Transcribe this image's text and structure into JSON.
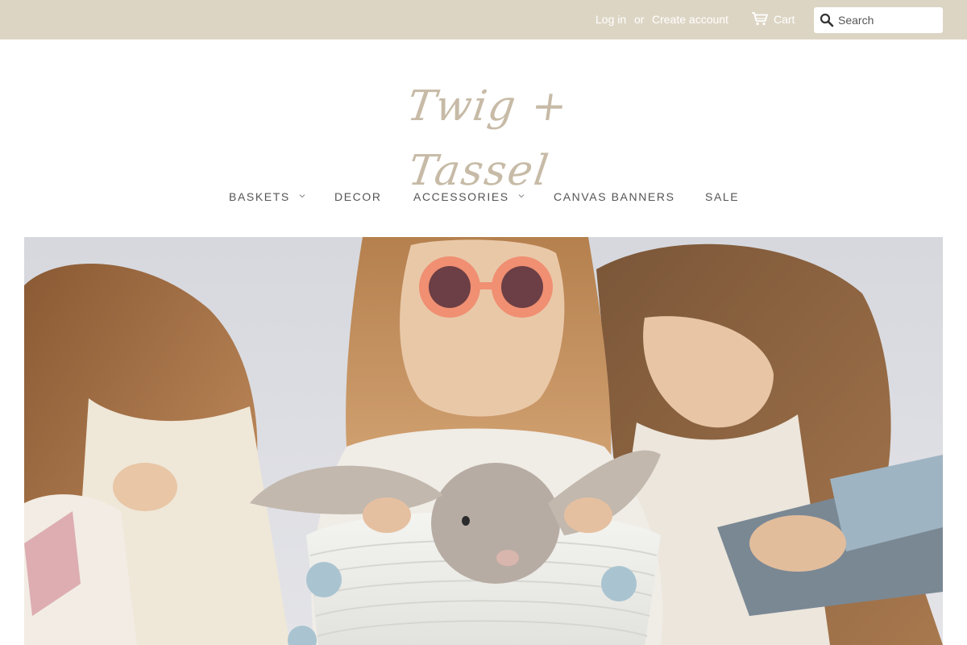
{
  "topbar": {
    "login_label": "Log in",
    "or_label": "or",
    "create_account_label": "Create account",
    "cart_icon": "cart-icon",
    "cart_label": "Cart",
    "search_icon": "search-icon",
    "search_placeholder": "Search",
    "background_color": "#ddd5c4"
  },
  "logo": {
    "text": "Twig + Tassel",
    "color": "#c7bba7"
  },
  "nav": {
    "items": [
      {
        "label": "BASKETS",
        "has_dropdown": true
      },
      {
        "label": "DECOR",
        "has_dropdown": false
      },
      {
        "label": "ACCESSORIES",
        "has_dropdown": true
      },
      {
        "label": "CANVAS BANNERS",
        "has_dropdown": false
      },
      {
        "label": "SALE",
        "has_dropdown": false
      }
    ]
  },
  "hero": {
    "image_subject": "three girls with plush bunny in rope basket"
  }
}
